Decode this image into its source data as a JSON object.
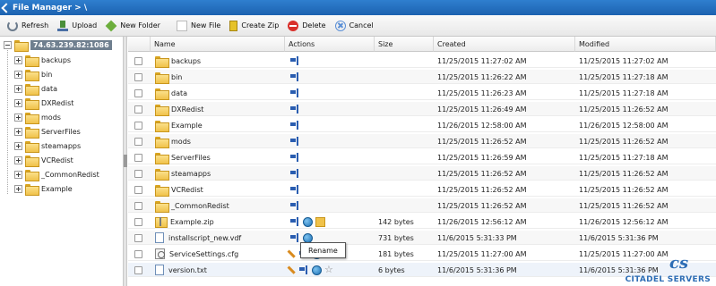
{
  "title": "File Manager > \\",
  "toolbar": [
    {
      "label": "Refresh",
      "icon": "refresh-icon"
    },
    {
      "label": "Upload",
      "icon": "upload-icon"
    },
    {
      "label": "New Folder",
      "icon": "new-folder-icon"
    },
    {
      "label": "New File",
      "icon": "new-file-icon"
    },
    {
      "label": "Create Zip",
      "icon": "zip-icon"
    },
    {
      "label": "Delete",
      "icon": "delete-icon"
    },
    {
      "label": "Cancel",
      "icon": "cancel-icon"
    }
  ],
  "tree": {
    "root": "74.63.239.82:1086",
    "items": [
      "backups",
      "bin",
      "data",
      "DXRedist",
      "mods",
      "ServerFiles",
      "steamapps",
      "VCRedist",
      "_CommonRedist",
      "Example"
    ]
  },
  "columns": {
    "name": "Name",
    "actions": "Actions",
    "size": "Size",
    "created": "Created",
    "modified": "Modified"
  },
  "rows": [
    {
      "name": "backups",
      "type": "folder",
      "size": "",
      "created": "11/25/2015 11:27:02 AM",
      "modified": "11/25/2015 11:27:02 AM"
    },
    {
      "name": "bin",
      "type": "folder",
      "size": "",
      "created": "11/25/2015 11:26:22 AM",
      "modified": "11/25/2015 11:27:18 AM"
    },
    {
      "name": "data",
      "type": "folder",
      "size": "",
      "created": "11/25/2015 11:26:23 AM",
      "modified": "11/25/2015 11:27:18 AM"
    },
    {
      "name": "DXRedist",
      "type": "folder",
      "size": "",
      "created": "11/25/2015 11:26:49 AM",
      "modified": "11/25/2015 11:26:52 AM"
    },
    {
      "name": "Example",
      "type": "folder",
      "size": "",
      "created": "11/26/2015 12:58:00 AM",
      "modified": "11/26/2015 12:58:00 AM"
    },
    {
      "name": "mods",
      "type": "folder",
      "size": "",
      "created": "11/25/2015 11:26:52 AM",
      "modified": "11/25/2015 11:26:52 AM"
    },
    {
      "name": "ServerFiles",
      "type": "folder",
      "size": "",
      "created": "11/25/2015 11:26:59 AM",
      "modified": "11/25/2015 11:27:18 AM"
    },
    {
      "name": "steamapps",
      "type": "folder",
      "size": "",
      "created": "11/25/2015 11:26:52 AM",
      "modified": "11/25/2015 11:26:52 AM"
    },
    {
      "name": "VCRedist",
      "type": "folder",
      "size": "",
      "created": "11/25/2015 11:26:52 AM",
      "modified": "11/25/2015 11:26:52 AM"
    },
    {
      "name": "_CommonRedist",
      "type": "folder",
      "size": "",
      "created": "11/25/2015 11:26:52 AM",
      "modified": "11/25/2015 11:26:52 AM"
    },
    {
      "name": "Example.zip",
      "type": "zip",
      "size": "142 bytes",
      "created": "11/26/2015 12:56:12 AM",
      "modified": "11/26/2015 12:56:12 AM"
    },
    {
      "name": "installscript_new.vdf",
      "type": "file",
      "size": "731 bytes",
      "created": "11/6/2015 5:31:33 PM",
      "modified": "11/6/2015 5:31:36 PM"
    },
    {
      "name": "ServiceSettings.cfg",
      "type": "cfg",
      "size": "181 bytes",
      "created": "11/25/2015 11:27:00 AM",
      "modified": "11/25/2015 11:27:00 AM"
    },
    {
      "name": "version.txt",
      "type": "file",
      "size": "6 bytes",
      "created": "11/6/2015 5:31:36 PM",
      "modified": "11/6/2015 5:31:36 PM"
    }
  ],
  "tooltip": "Rename",
  "logo": {
    "brand": "CITADEL SERVERS",
    "color": "#2d6db5"
  },
  "colors": {
    "titlebar": "#1c62b0",
    "rootBadge": "#6f7f8f"
  }
}
